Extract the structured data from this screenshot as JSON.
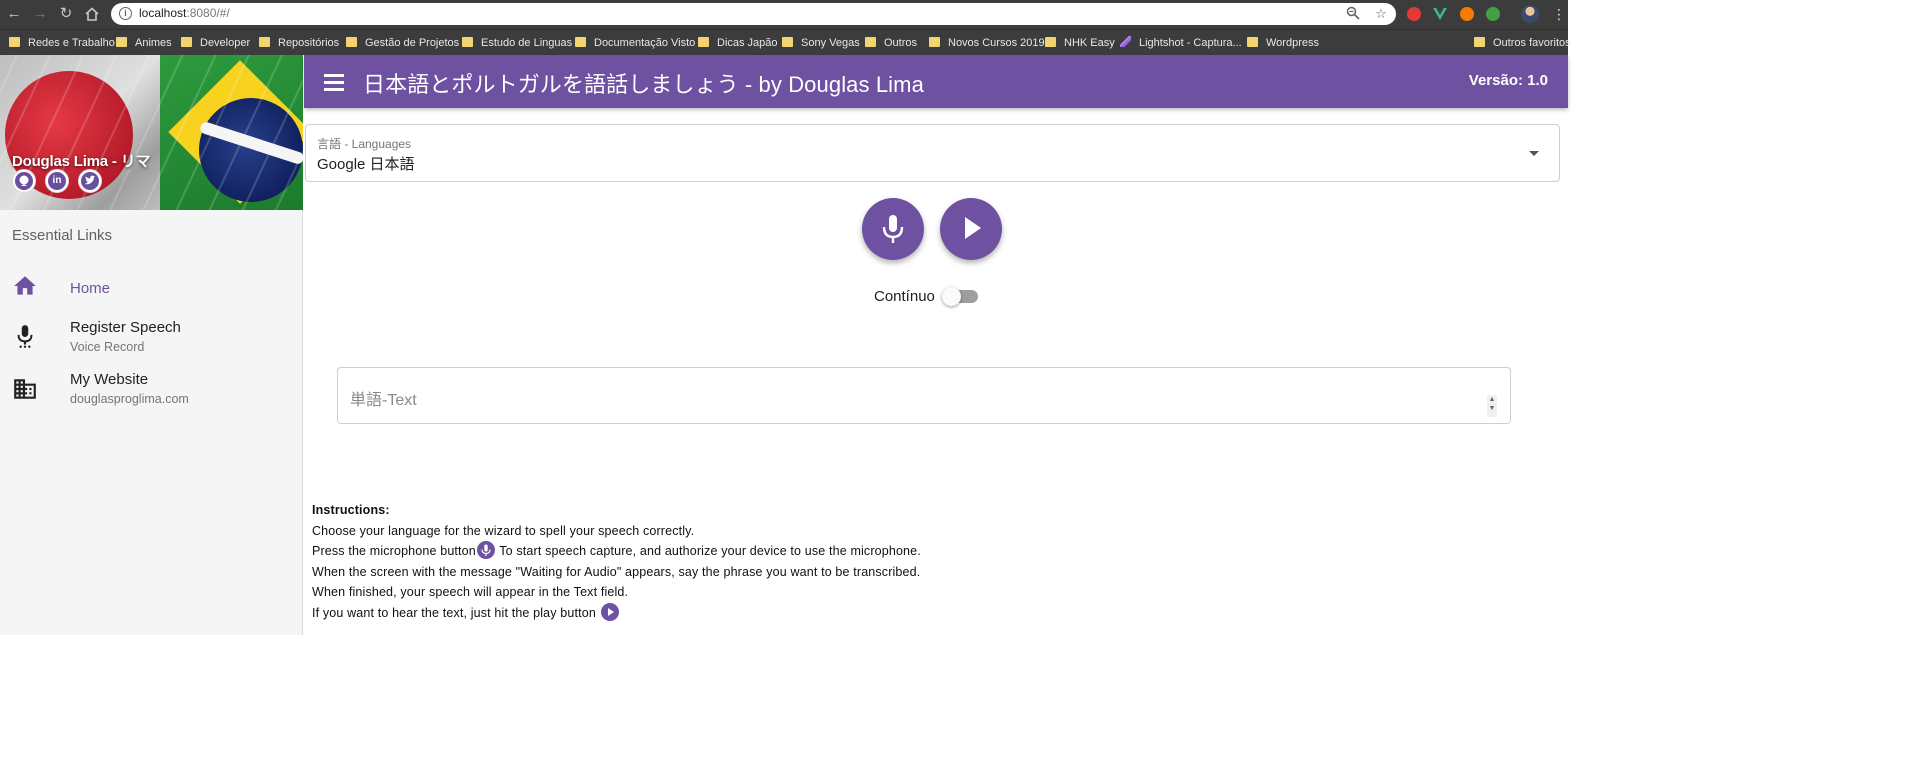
{
  "browser": {
    "url_host": "localhost",
    "url_rest": ":8080/#/",
    "bookmarks": [
      "Redes e Trabalho",
      "Animes",
      "Developer",
      "Repositórios",
      "Gestão de Projetos",
      "Estudo de Linguas",
      "Documentação Visto",
      "Dicas Japão",
      "Sony Vegas",
      "Outros",
      "Novos Cursos 2019",
      "NHK Easy",
      "Lightshot - Captura...",
      "Wordpress"
    ],
    "other_bookmarks": "Outros favoritos"
  },
  "drawer": {
    "profile_name": "Douglas Lima - リマ",
    "section_label": "Essential Links",
    "items": [
      {
        "title": "Home",
        "subtitle": "",
        "icon": "home-icon"
      },
      {
        "title": "Register Speech",
        "subtitle": "Voice Record",
        "icon": "mic-icon"
      },
      {
        "title": "My Website",
        "subtitle": "douglasproglima.com",
        "icon": "business-icon"
      }
    ],
    "social": [
      "github-icon",
      "linkedin-icon",
      "twitter-icon"
    ]
  },
  "appbar": {
    "title": "日本語とポルトガルを語話しましょう - by Douglas Lima",
    "version": "Versão: 1.0"
  },
  "language_select": {
    "label": "言語 - Languages",
    "value": "Google 日本語"
  },
  "controls": {
    "continuous_label": "Contínuo",
    "continuous_on": false
  },
  "text_field": {
    "placeholder": "単語-Text"
  },
  "instructions": {
    "heading": "Instructions:",
    "line1": "Choose your language for the wizard to spell your speech correctly.",
    "line2_a": "Press the microphone button",
    "line2_b": " To start speech capture, and authorize your device to use the microphone.",
    "line3": "When the screen with the message \"Waiting for Audio\" appears, say the phrase you want to be transcribed.",
    "line4": "When finished, your speech will appear in the Text field.",
    "line5": "If you want to hear the text, just hit the play button"
  },
  "colors": {
    "primary": "#6e52a1",
    "chrome": "#3c3c3c"
  }
}
